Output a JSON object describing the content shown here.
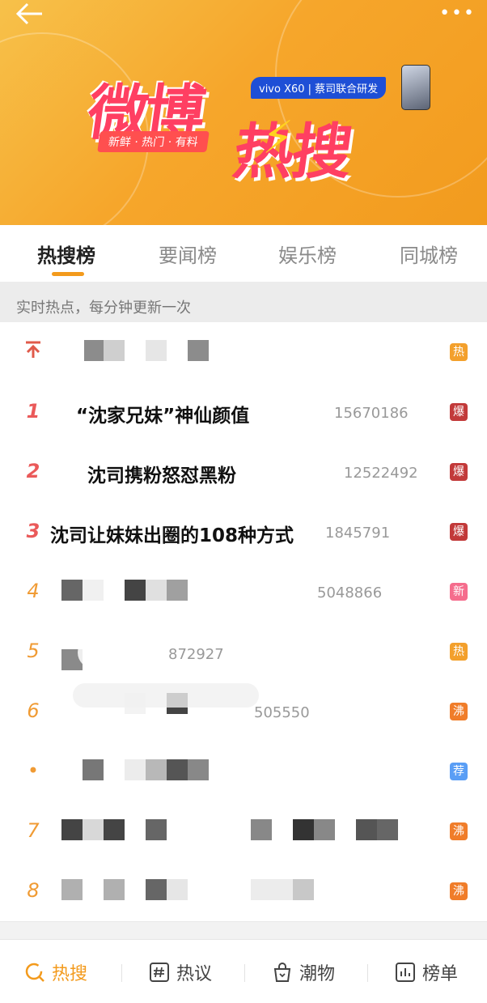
{
  "header": {
    "back_icon": "arrow-left-icon",
    "more_icon": "more-dots-icon"
  },
  "banner": {
    "logo_text_main": "微博",
    "logo_text_hot": "热搜",
    "tagline": "新鲜 · 热门 · 有料",
    "sponsor": "vivo X60 | 蔡司联合研发"
  },
  "tabs": [
    {
      "label": "热搜榜",
      "active": true
    },
    {
      "label": "要闻榜",
      "active": false
    },
    {
      "label": "娱乐榜",
      "active": false
    },
    {
      "label": "同城榜",
      "active": false
    }
  ],
  "subtitle": "实时热点，每分钟更新一次",
  "rows": [
    {
      "rank": "↑",
      "title": "",
      "count": "",
      "badge": "热",
      "badge_color": "#f3a02c"
    },
    {
      "rank": "1",
      "title": "“沈家兄妹”神仙颜值",
      "count": "15670186",
      "badge": "爆",
      "badge_color": "#c23a3a"
    },
    {
      "rank": "2",
      "title": "沈司携粉怒怼黑粉",
      "count": "12522492",
      "badge": "爆",
      "badge_color": "#c23a3a"
    },
    {
      "rank": "3",
      "title": "沈司让妹妹出圈的108种方式",
      "count": "1845791",
      "badge": "爆",
      "badge_color": "#c23a3a"
    },
    {
      "rank": "4",
      "title": "",
      "count": "5048866",
      "badge": "新",
      "badge_color": "#f56d8d"
    },
    {
      "rank": "5",
      "title": "",
      "count": "872927",
      "badge": "热",
      "badge_color": "#f3a02c"
    },
    {
      "rank": "6",
      "title": "",
      "count": "505550",
      "badge": "沸",
      "badge_color": "#f07d2a"
    },
    {
      "rank": "•",
      "title": "",
      "count": "",
      "badge": "荐",
      "badge_color": "#5a9ef5"
    },
    {
      "rank": "7",
      "title": "",
      "count": "",
      "badge": "沸",
      "badge_color": "#f07d2a"
    },
    {
      "rank": "8",
      "title": "",
      "count": "",
      "badge": "沸",
      "badge_color": "#f07d2a"
    }
  ],
  "bottom_nav": [
    {
      "label": "热搜",
      "icon": "search-icon",
      "active": true
    },
    {
      "label": "热议",
      "icon": "hashtag-icon",
      "active": false
    },
    {
      "label": "潮物",
      "icon": "bag-icon",
      "active": false
    },
    {
      "label": "榜单",
      "icon": "chart-bar-icon",
      "active": false
    }
  ]
}
